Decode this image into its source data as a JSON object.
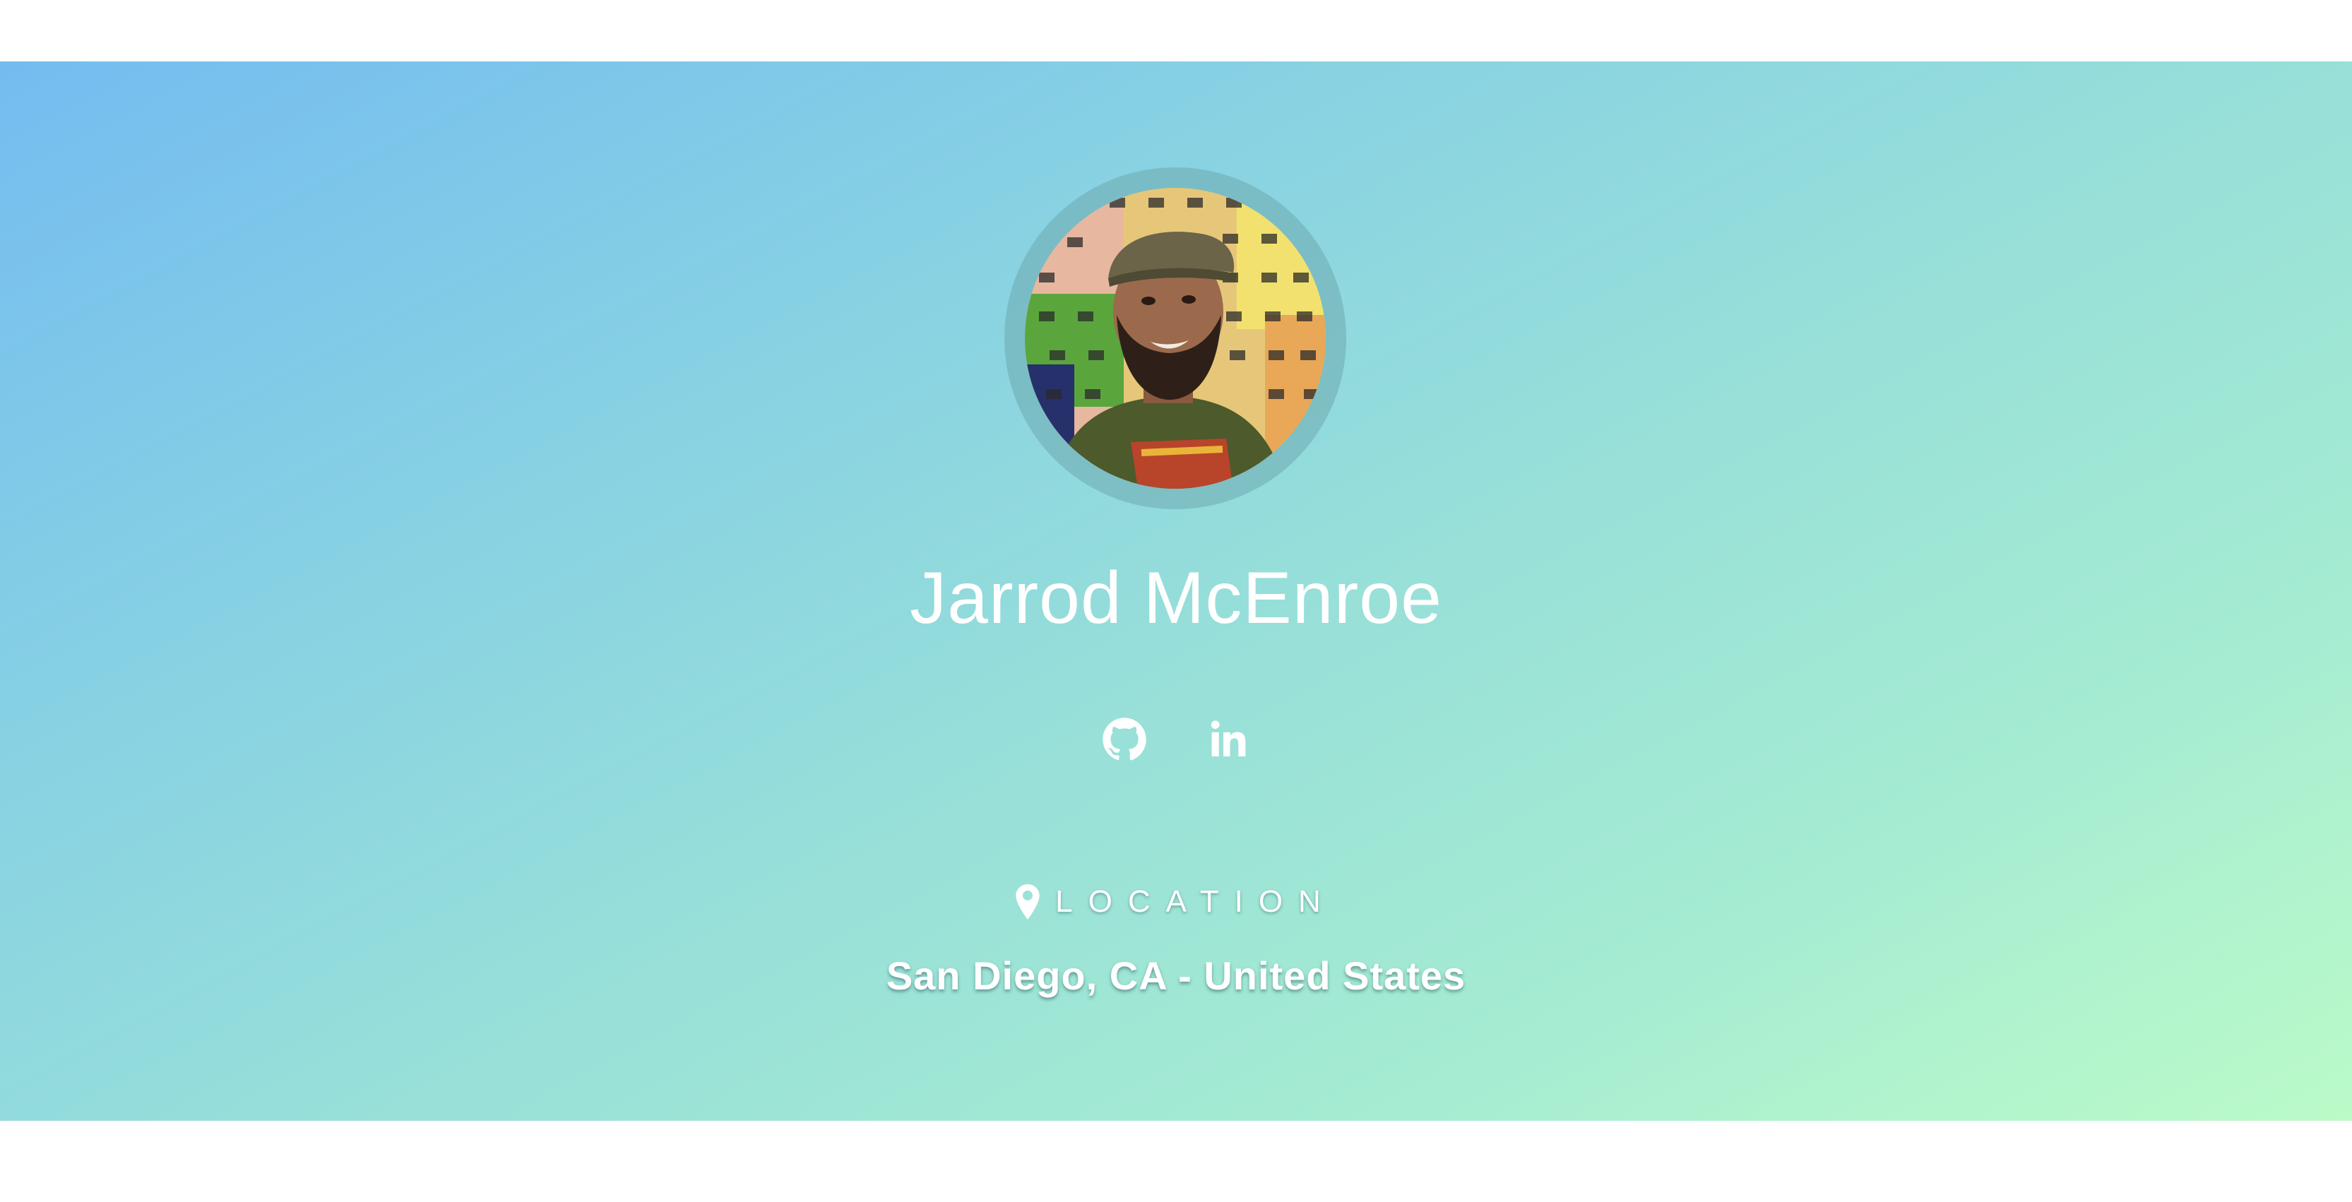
{
  "profile": {
    "name": "Jarrod McEnroe",
    "avatar_icon": "profile-photo"
  },
  "socials": [
    {
      "icon": "github-icon",
      "label": "GitHub"
    },
    {
      "icon": "linkedin-icon",
      "label": "LinkedIn"
    }
  ],
  "location": {
    "label": "LOCATION",
    "icon": "map-pin-icon",
    "value": "San Diego, CA - United States"
  },
  "colors": {
    "gradient_start": "#74bcf0",
    "gradient_end": "#bbfbc8",
    "text": "#ffffff"
  }
}
